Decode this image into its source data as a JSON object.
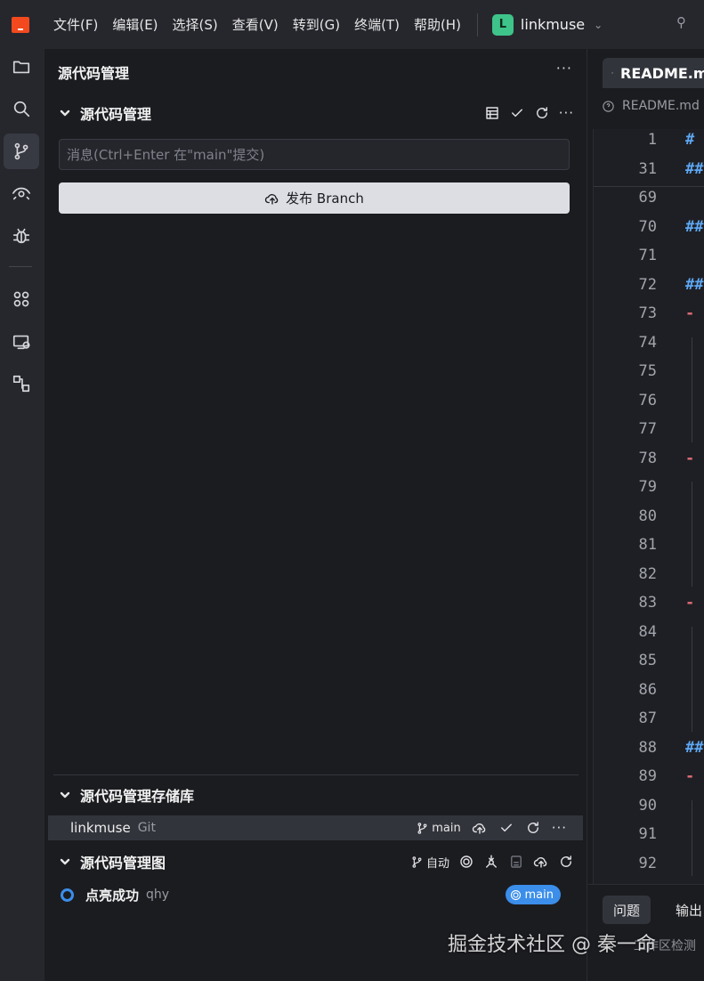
{
  "menu": [
    "文件(F)",
    "编辑(E)",
    "选择(S)",
    "查看(V)",
    "转到(G)",
    "终端(T)",
    "帮助(H)"
  ],
  "project": {
    "badge": "L",
    "name": "linkmuse",
    "badge_color": "#3ec38a"
  },
  "activity_bar": [
    "explorer-icon",
    "search-icon",
    "source-control-icon",
    "eye-icon",
    "debug-icon",
    "extensions-icon",
    "remote-icon",
    "git-graph-icon"
  ],
  "panel": {
    "title": "源代码管理",
    "scm_section_title": "源代码管理",
    "commit_placeholder": "消息(Ctrl+Enter 在\"main\"提交)",
    "publish_label": "发布 Branch",
    "repos_title": "源代码管理存储库",
    "repo": {
      "name": "linkmuse",
      "type": "Git",
      "branch": "main"
    },
    "graph_title": "源代码管理图",
    "graph_auto": "自动",
    "commit": {
      "message": "点亮成功",
      "author": "qhy",
      "branch": "main"
    }
  },
  "editor": {
    "tab_label": "README.md",
    "breadcrumb": "README.md",
    "lines": [
      {
        "n": "1",
        "tok": "#"
      },
      {
        "n": "31",
        "tok": "##"
      },
      {
        "n": "69",
        "tok": ""
      },
      {
        "n": "70",
        "tok": "##"
      },
      {
        "n": "71",
        "tok": ""
      },
      {
        "n": "72",
        "tok": "##"
      },
      {
        "n": "73",
        "tok": "-"
      },
      {
        "n": "74",
        "tok": ""
      },
      {
        "n": "75",
        "tok": ""
      },
      {
        "n": "76",
        "tok": ""
      },
      {
        "n": "77",
        "tok": ""
      },
      {
        "n": "78",
        "tok": "-"
      },
      {
        "n": "79",
        "tok": ""
      },
      {
        "n": "80",
        "tok": ""
      },
      {
        "n": "81",
        "tok": ""
      },
      {
        "n": "82",
        "tok": ""
      },
      {
        "n": "83",
        "tok": "-"
      },
      {
        "n": "84",
        "tok": ""
      },
      {
        "n": "85",
        "tok": ""
      },
      {
        "n": "86",
        "tok": ""
      },
      {
        "n": "87",
        "tok": ""
      },
      {
        "n": "88",
        "tok": "##"
      },
      {
        "n": "89",
        "tok": "-"
      },
      {
        "n": "90",
        "tok": ""
      },
      {
        "n": "91",
        "tok": ""
      },
      {
        "n": "92",
        "tok": ""
      }
    ]
  },
  "bottom_panel": {
    "tabs": [
      "问题",
      "输出"
    ],
    "sub_text": "工作区检测"
  },
  "watermark": "掘金技术社区 @ 秦一命",
  "colors": {
    "accent": "#3b8eea",
    "logo": "#f4491f",
    "heading_token": "#5ea8f5",
    "list_token": "#e06c75"
  }
}
